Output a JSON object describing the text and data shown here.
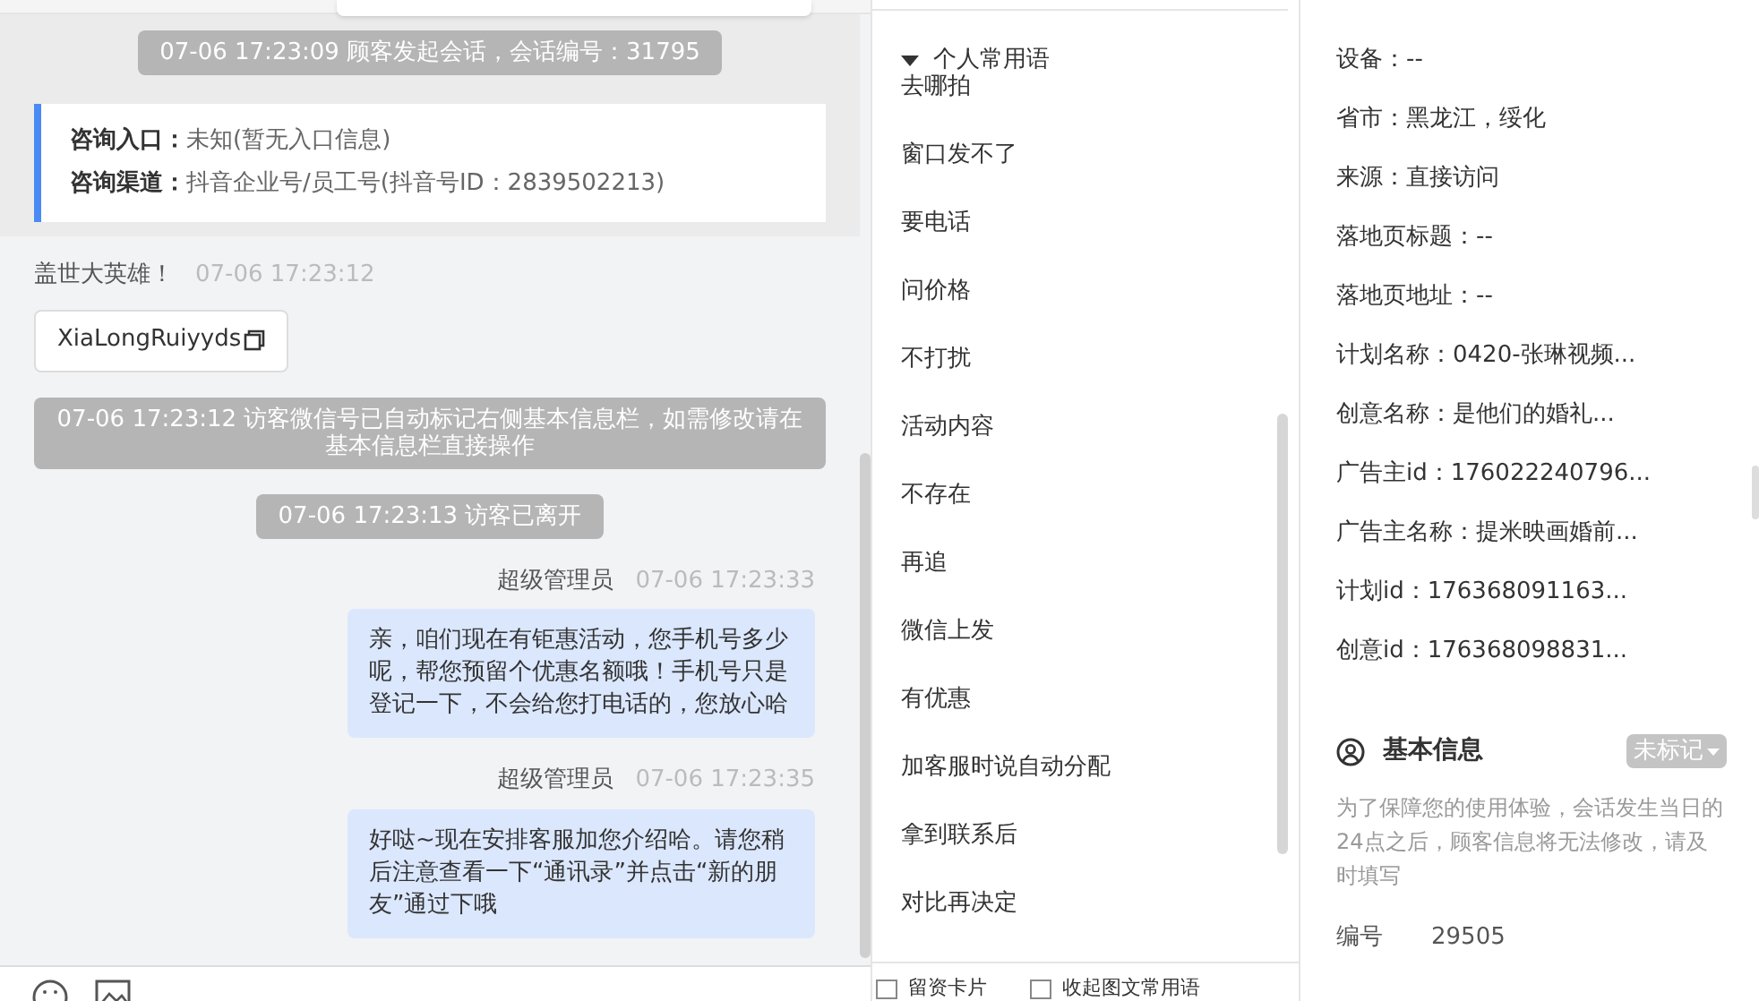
{
  "chat": {
    "session_notice": "07-06 17:23:09 顾客发起会话，会话编号：31795",
    "entry_card": [
      {
        "label": "咨询入口：",
        "value": "未知(暂无入口信息)"
      },
      {
        "label": "咨询渠道：",
        "value": "抖音企业号/员工号(抖音号ID：2839502213)"
      }
    ],
    "messages": [
      {
        "kind": "visitor",
        "sender": "盖世大英雄！",
        "time": "07-06 17:23:12",
        "text": "XiaLongRuiyyds"
      },
      {
        "kind": "system",
        "text": "07-06 17:23:12 访客微信号已自动标记右侧基本信息栏，如需修改请在基本信息栏直接操作"
      },
      {
        "kind": "system",
        "text": "07-06 17:23:13 访客已离开"
      },
      {
        "kind": "agent",
        "sender": "超级管理员",
        "time": "07-06 17:23:33",
        "text": "亲，咱们现在有钜惠活动，您手机号多少呢，帮您预留个优惠名额哦！手机号只是登记一下，不会给您打电话的，您放心哈"
      },
      {
        "kind": "agent",
        "sender": "超级管理员",
        "time": "07-06 17:23:35",
        "text": "好哒~现在安排客服加您介绍哈。请您稍后注意查看一下“通讯录”并点击“新的朋友”通过下哦"
      }
    ]
  },
  "phrases": {
    "group": "个人常用语",
    "expanded": true,
    "items": [
      "去哪拍",
      "窗口发不了",
      "要电话",
      "问价格",
      "不打扰",
      "活动内容",
      "不存在",
      "再追",
      "微信上发",
      "有优惠",
      "加客服时说自动分配",
      "拿到联系后",
      "对比再决定"
    ]
  },
  "footer_options": [
    {
      "label": "留资卡片",
      "checked": false
    },
    {
      "label": "收起图文常用语",
      "checked": false
    }
  ],
  "visitor_info": [
    "设备：--",
    "省市：黑龙江，绥化",
    "来源：直接访问",
    "落地页标题：--",
    "落地页地址：--",
    "计划名称：0420-张琳视频...",
    "创意名称：是他们的婚礼...",
    "广告主id：176022240796...",
    "广告主名称：提米映画婚前...",
    "计划id：176368091163...",
    "创意id：176368098831..."
  ],
  "basic_info": {
    "title": "基本信息",
    "mark_button": "未标记",
    "notice": "为了保障您的使用体验，会话发生当日的24点之后，顾客信息将无法修改，请及时填写",
    "fields": [
      {
        "label": "编号",
        "value": "29505"
      }
    ]
  }
}
